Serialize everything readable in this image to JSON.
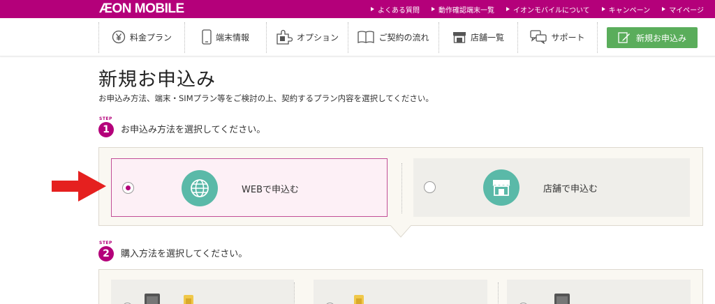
{
  "header": {
    "logo": "ÆON MOBILE",
    "links": [
      "よくある質問",
      "動作確認端末一覧",
      "イオンモバイルについて",
      "キャンペーン",
      "マイページ"
    ]
  },
  "nav": {
    "items": [
      {
        "label": "料金プラン",
        "icon": "yen-icon"
      },
      {
        "label": "端末情報",
        "icon": "phone-icon"
      },
      {
        "label": "オプション",
        "icon": "puzzle-icon"
      },
      {
        "label": "ご契約の流れ",
        "icon": "book-icon"
      },
      {
        "label": "店舗一覧",
        "icon": "store-icon"
      },
      {
        "label": "サポート",
        "icon": "chat-icon"
      }
    ],
    "apply_button": "新規お申込み"
  },
  "page": {
    "title": "新規お申込み",
    "description": "お申込み方法、端末・SIMプラン等をご検討の上、契約するプラン内容を選択してください。"
  },
  "steps": [
    {
      "badge_word": "STEP",
      "number": "1",
      "text": "お申込み方法を選択してください。",
      "options": [
        {
          "label": "WEBで申込む",
          "icon": "globe-icon",
          "selected": true
        },
        {
          "label": "店舗で申込む",
          "icon": "store-icon",
          "selected": false
        }
      ]
    },
    {
      "badge_word": "STEP",
      "number": "2",
      "text": "購入方法を選択してください。"
    }
  ],
  "colors": {
    "brand": "#b4007a",
    "accent_green": "#5aad5b",
    "icon_teal": "#5ab9a8",
    "arrow_red": "#e5201f"
  }
}
